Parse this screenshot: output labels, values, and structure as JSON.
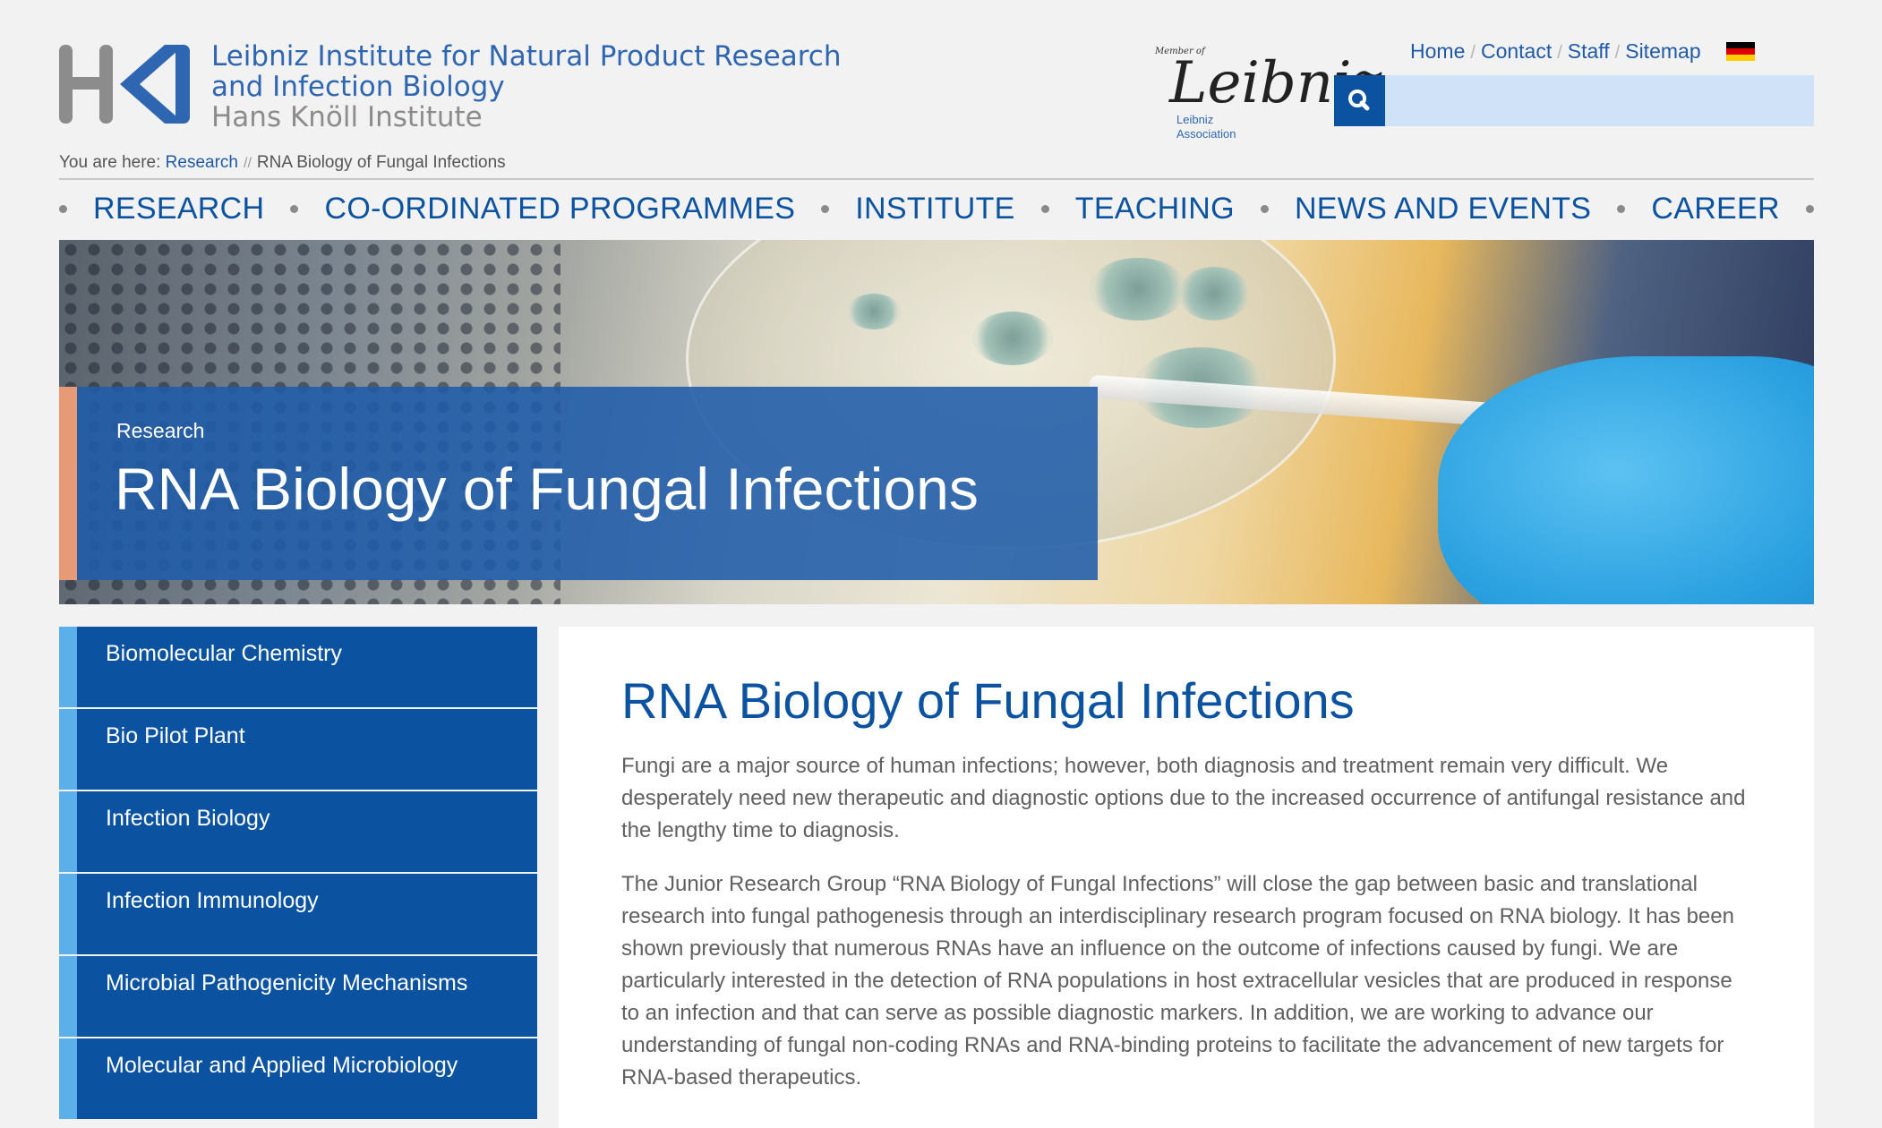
{
  "header": {
    "logo": {
      "mark": "HKI",
      "line1": "Leibniz Institute for Natural Product Research",
      "line2": "and Infection Biology",
      "line3": "Hans Knöll Institute"
    },
    "leibniz_badge": {
      "member_of": "Member of",
      "signature": "Leibniz",
      "association": [
        "Leibniz",
        "Association"
      ]
    },
    "top_links": [
      "Home",
      "Contact",
      "Staff",
      "Sitemap"
    ],
    "language_flag_icon": "german-flag-icon",
    "search": {
      "icon": "search-icon",
      "value": "",
      "placeholder": ""
    }
  },
  "breadcrumb": {
    "prefix": "You are here:",
    "items": [
      "Research",
      "RNA Biology of Fungal Infections"
    ]
  },
  "main_nav": [
    "RESEARCH",
    "CO-ORDINATED PROGRAMMES",
    "INSTITUTE",
    "TEACHING",
    "NEWS AND EVENTS",
    "CAREER"
  ],
  "hero": {
    "kicker": "Research",
    "title": "RNA Biology of Fungal Infections"
  },
  "sidebar": {
    "items": [
      "Biomolecular Chemistry",
      "Bio Pilot Plant",
      "Infection Biology",
      "Infection Immunology",
      "Microbial Pathogenicity Mechanisms",
      "Molecular and Applied Microbiology"
    ]
  },
  "content": {
    "title": "RNA Biology of Fungal Infections",
    "paragraphs": [
      "Fungi are a major source of human infections; however, both diagnosis and treatment remain very difficult. We desperately need new therapeutic and diagnostic options due to the increased occurrence of antifungal resistance and the lengthy time to diagnosis.",
      "The Junior Research Group “RNA Biology of Fungal Infections” will close the gap between basic and translational research into fungal pathogenesis through an interdisciplinary research program focused on RNA biology. It has been shown previously that numerous RNAs have an influence on the outcome of infections caused by fungi. We are particularly interested in the detection of RNA populations in host extracellular vesicles that are produced in response to an infection and that can serve as possible diagnostic markers. In addition, we are working to advance our understanding of fungal non-coding RNAs and RNA-binding proteins to facilitate the advancement of new targets for RNA-based therapeutics."
    ]
  },
  "colors": {
    "brand_blue": "#0b53a1",
    "link_blue": "#1f5aa8",
    "sidebar_accent": "#5cb0ea",
    "hero_accent": "#e79a76",
    "search_field": "#cfe2f7"
  }
}
